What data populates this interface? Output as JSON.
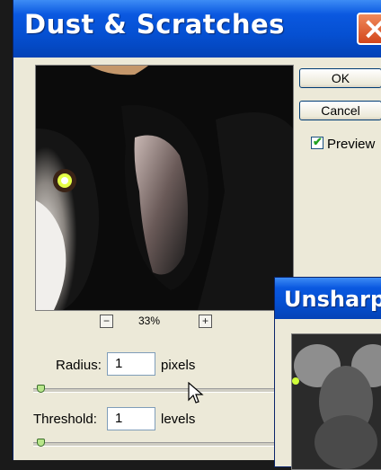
{
  "dialog": {
    "title": "Dust & Scratches",
    "ok_label": "OK",
    "cancel_label": "Cancel",
    "preview_checked": true,
    "preview_label": "Preview",
    "zoom": {
      "minus": "−",
      "value": "33%",
      "plus": "+"
    },
    "radius": {
      "label": "Radius:",
      "value": "1",
      "unit": "pixels",
      "slider_level": 0.02
    },
    "threshold": {
      "label": "Threshold:",
      "value": "1",
      "unit": "levels",
      "slider_level": 0.02
    }
  },
  "background_dialog": {
    "title": "Unsharp"
  },
  "colors": {
    "title_bar": "#0550d2",
    "close_button": "#d2461c",
    "dialog_bg": "#ece9d8"
  }
}
